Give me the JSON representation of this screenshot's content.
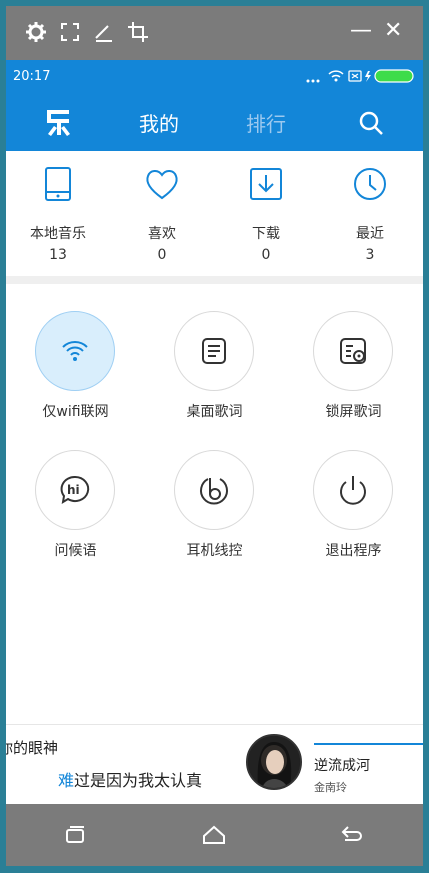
{
  "emulator_toolbar": {
    "icons": [
      "gear-icon",
      "expand-icon",
      "pen-icon",
      "crop-icon"
    ],
    "minimize": "—",
    "close": "✕"
  },
  "status_bar": {
    "time": "20:17",
    "battery_color": "#3ddc4a"
  },
  "header": {
    "logo": "music-logo-icon",
    "tabs": [
      {
        "label": "我的",
        "active": true
      },
      {
        "label": "排行",
        "active": false
      }
    ],
    "search_icon": "search-icon",
    "accent": "#1386d8"
  },
  "stats": [
    {
      "label": "本地音乐",
      "count": "13",
      "icon": "tablet-icon"
    },
    {
      "label": "喜欢",
      "count": "0",
      "icon": "heart-icon"
    },
    {
      "label": "下载",
      "count": "0",
      "icon": "download-icon"
    },
    {
      "label": "最近",
      "count": "3",
      "icon": "clock-icon"
    }
  ],
  "grid": [
    {
      "label": "仅wifi联网",
      "icon": "wifi-icon",
      "active": true
    },
    {
      "label": "桌面歌词",
      "icon": "lyrics-icon",
      "active": false
    },
    {
      "label": "锁屏歌词",
      "icon": "lock-lyrics-icon",
      "active": false
    },
    {
      "label": "问候语",
      "icon": "hi-bubble-icon",
      "active": false
    },
    {
      "label": "耳机线控",
      "icon": "earphone-icon",
      "active": false
    },
    {
      "label": "退出程序",
      "icon": "power-icon",
      "active": false
    }
  ],
  "player": {
    "lyric_line1": "你的眼神",
    "lyric_line2_highlight": "难",
    "lyric_line2_rest": "过是因为我太认真",
    "song_title": "逆流成河",
    "artist": "金南玲"
  },
  "navbar": {
    "icons": [
      "recent-apps-icon",
      "home-icon",
      "back-icon"
    ]
  }
}
